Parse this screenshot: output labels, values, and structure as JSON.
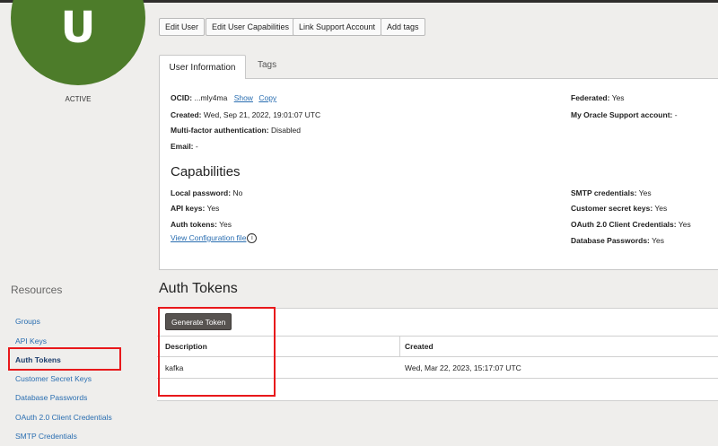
{
  "avatar": {
    "initial": "U",
    "status": "ACTIVE"
  },
  "actions": {
    "edit_user": "Edit User",
    "edit_capabilities": "Edit User Capabilities",
    "link_support": "Link Support Account",
    "add_tags": "Add tags"
  },
  "tabs": {
    "user_info": "User Information",
    "tags": "Tags"
  },
  "user_info": {
    "ocid_label": "OCID:",
    "ocid_value": "...mly4ma",
    "show": "Show",
    "copy": "Copy",
    "created_label": "Created:",
    "created_value": "Wed, Sep 21, 2022, 19:01:07 UTC",
    "mfa_label": "Multi-factor authentication:",
    "mfa_value": "Disabled",
    "email_label": "Email:",
    "email_value": "-",
    "federated_label": "Federated:",
    "federated_value": "Yes",
    "support_label": "My Oracle Support account:",
    "support_value": "-"
  },
  "capabilities": {
    "heading": "Capabilities",
    "local_password_label": "Local password:",
    "local_password_value": "No",
    "api_keys_label": "API keys:",
    "api_keys_value": "Yes",
    "auth_tokens_label": "Auth tokens:",
    "auth_tokens_value": "Yes",
    "view_config": "View Configuration file",
    "smtp_label": "SMTP credentials:",
    "smtp_value": "Yes",
    "customer_secret_label": "Customer secret keys:",
    "customer_secret_value": "Yes",
    "oauth_label": "OAuth 2.0 Client Credentials:",
    "oauth_value": "Yes",
    "db_passwords_label": "Database Passwords:",
    "db_passwords_value": "Yes"
  },
  "resources": {
    "title": "Resources",
    "items": [
      "Groups",
      "API Keys",
      "Auth Tokens",
      "Customer Secret Keys",
      "Database Passwords",
      "OAuth 2.0 Client Credentials",
      "SMTP Credentials"
    ],
    "active_index": 2
  },
  "auth_tokens": {
    "heading": "Auth Tokens",
    "generate_button": "Generate Token",
    "columns": [
      "Description",
      "Created"
    ],
    "rows": [
      {
        "description": "kafka",
        "created": "Wed, Mar 22, 2023, 15:17:07 UTC"
      }
    ]
  },
  "colors": {
    "avatar_bg": "#4d7c2a",
    "link": "#2a6eb1",
    "highlight": "#e8181b",
    "primary_button": "#575350"
  }
}
